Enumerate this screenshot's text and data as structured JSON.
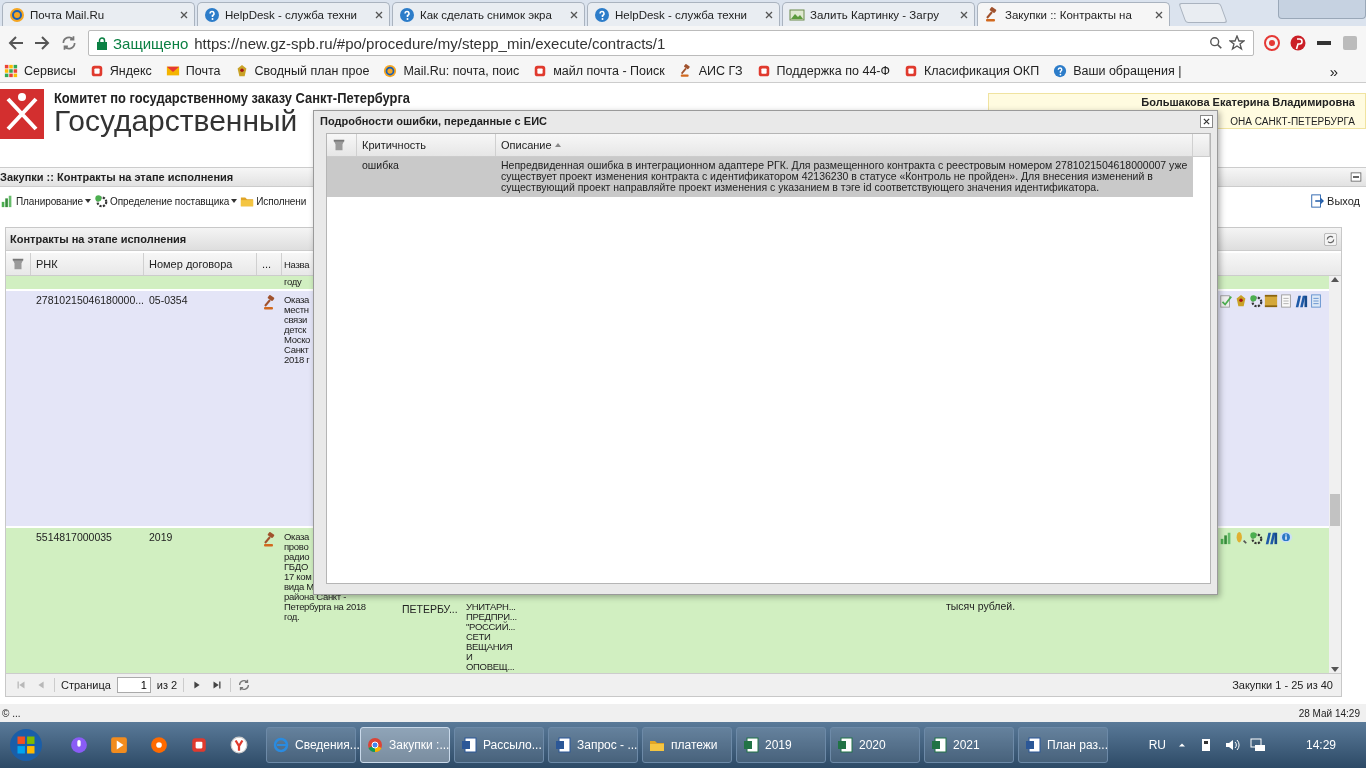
{
  "browser": {
    "tabs": [
      {
        "title": "Почта Mail.Ru",
        "kind": "at",
        "selected": false
      },
      {
        "title": "HelpDesk - служба техни",
        "kind": "help",
        "selected": false
      },
      {
        "title": "Как сделать снимок экра",
        "kind": "help",
        "selected": false
      },
      {
        "title": "HelpDesk - служба техни",
        "kind": "help",
        "selected": false
      },
      {
        "title": "Залить Картинку - Загру",
        "kind": "image",
        "selected": false
      },
      {
        "title": "Закупки :: Контракты на",
        "kind": "gavel",
        "selected": true
      }
    ],
    "security": "Защищено",
    "url": "https://new.gz-spb.ru/#po/procedure/my/stepp_min/execute/contracts/1",
    "bookmarks": [
      {
        "label": "Сервисы",
        "kind": "apps"
      },
      {
        "label": "Яндекс",
        "kind": "logo"
      },
      {
        "label": "Почта",
        "kind": "envelope"
      },
      {
        "label": "Сводный план прое",
        "kind": "emblem"
      },
      {
        "label": "Mail.Ru: почта, поис",
        "kind": "at"
      },
      {
        "label": "майл почта - Поиск",
        "kind": "logo"
      },
      {
        "label": "АИС ГЗ",
        "kind": "gavel"
      },
      {
        "label": "Поддержка по 44-Ф",
        "kind": "logo"
      },
      {
        "label": "Класификация ОКП",
        "kind": "logo"
      },
      {
        "label": "Ваши обращения |",
        "kind": "help"
      }
    ],
    "more": "»"
  },
  "header": {
    "org": "Комитет по государственному заказу Санкт-Петербурга",
    "title": "Государственный",
    "user_name": "Большакова Екатерина Владимировна",
    "user_org": "ОНА САНКТ-ПЕТЕРБУРГА"
  },
  "panel": {
    "title": "Закупки :: Контракты на этапе исполнения"
  },
  "toolbar": {
    "items": [
      {
        "label": "Планирование",
        "kind": "chart",
        "dropdown": true
      },
      {
        "label": "Определение поставщика",
        "kind": "gear",
        "dropdown": true
      },
      {
        "label": "Исполнени",
        "kind": "folder",
        "dropdown": false
      }
    ],
    "exit": "Выход"
  },
  "grid": {
    "title": "Контракты на этапе исполнения",
    "columns": [
      "РНК",
      "Номер договора",
      "...",
      "Назва"
    ],
    "rows": [
      {
        "kind": "partial",
        "color": "#d1efc1",
        "name": "году"
      },
      {
        "kind": "full",
        "color": "#e4e5f7",
        "rnk": "27810215046180000...",
        "number": "05-0354",
        "name": "Оказа\nместн\nсвязи\nдетск\nМоско\nСанкт\n2018 г",
        "actions": [
          {
            "kind": "check"
          },
          {
            "kind": "emblem"
          },
          {
            "kind": "gear"
          },
          {
            "kind": "scroll"
          },
          {
            "kind": "doc"
          },
          {
            "kind": "books"
          },
          {
            "kind": "notes"
          }
        ]
      },
      {
        "kind": "full",
        "color": "#d1efc1",
        "rnk": "5514817000035",
        "number": "2019",
        "name": "Оказа\nпрово\nрадио\nГБДО\n17 ком\nвида М\nрайона Санкт -\nПетербурга на 2018\nгод.",
        "col5": "ПЕТЕРБУ...",
        "col6": "УНИТАРН...\nПРЕДПРИ...\n\"РОССИЙ...\nСЕТИ\nВЕЩАНИЯ\nИ\nОПОВЕЩ...",
        "col8": "тысяч рублей.",
        "actions": [
          {
            "kind": "chart"
          },
          {
            "kind": "coin"
          },
          {
            "kind": "gear"
          },
          {
            "kind": "books"
          },
          {
            "kind": "info"
          }
        ]
      }
    ],
    "pager": {
      "back": [
        {
          "kind": "first",
          "disabled": true
        },
        {
          "kind": "prev",
          "disabled": true
        }
      ],
      "label": "Страница",
      "page": "1",
      "of": "из 2",
      "forward": [
        {
          "kind": "next",
          "disabled": false
        },
        {
          "kind": "last",
          "disabled": false
        }
      ],
      "summary": "Закупки 1 - 25 из 40"
    }
  },
  "dialog": {
    "title": "Подробности ошибки, переданные с ЕИС",
    "columns": [
      "Критичность",
      "Описание"
    ],
    "rows": [
      {
        "severity": "ошибка",
        "description": "Непредвиденная ошибка в интеграционном адаптере РГК. Для размещенного контракта с реестровым номером 2781021504618000007 уже существует проект изменения контракта с идентификатором 42136230 в статусе «Контроль не пройден». Для внесения изменений в существующий проект направляйте проект изменения с указанием в тэге id соответствующего значения идентификатора.",
        "selected": true
      }
    ]
  },
  "status": {
    "left": "© ...",
    "right": "28 Май 14:29"
  },
  "taskbar": {
    "windows": [
      {
        "label": "Сведения...",
        "kind": "ie",
        "selected": false
      },
      {
        "label": "Закупки :...",
        "kind": "chrome",
        "selected": true
      },
      {
        "label": "Рассыло...",
        "kind": "word",
        "selected": false
      },
      {
        "label": "Запрос - ...",
        "kind": "word",
        "selected": false
      },
      {
        "label": "платежи",
        "kind": "folder",
        "selected": false
      },
      {
        "label": "2019",
        "kind": "excel",
        "selected": false
      },
      {
        "label": "2020",
        "kind": "excel",
        "selected": false
      },
      {
        "label": "2021",
        "kind": "excel",
        "selected": false
      },
      {
        "label": "План раз...",
        "kind": "word",
        "selected": false
      }
    ],
    "language": "RU",
    "time": "14:29"
  }
}
